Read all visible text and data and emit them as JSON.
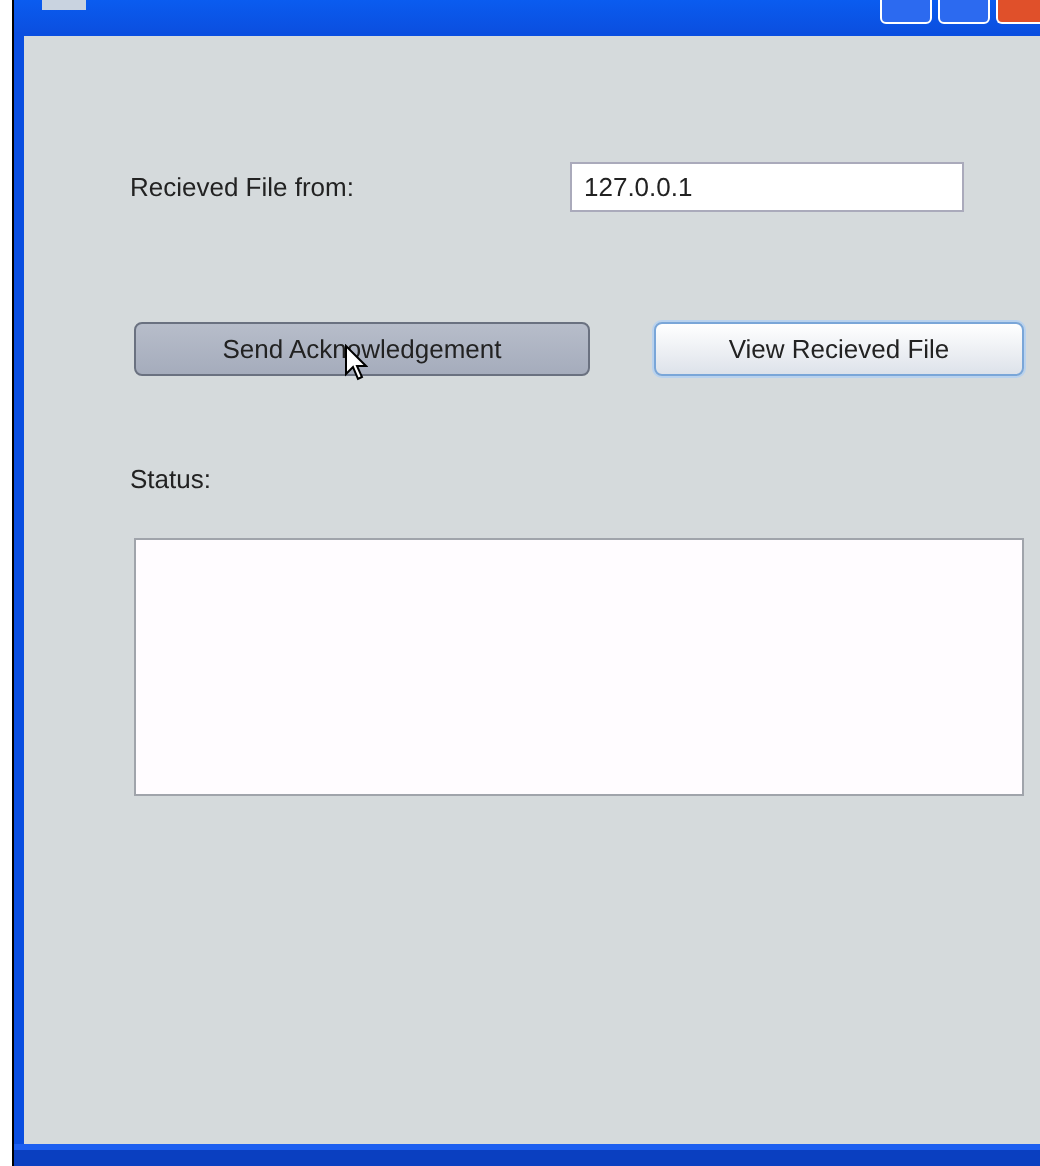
{
  "window": {
    "buttons": [
      {
        "kind": "minimize"
      },
      {
        "kind": "maximize"
      },
      {
        "kind": "close"
      }
    ]
  },
  "source": {
    "label": "Recieved File from:",
    "value": "127.0.0.1"
  },
  "actions": [
    {
      "label": "Send Acknowledgement",
      "pressed": true,
      "focused": false
    },
    {
      "label": "View Recieved File",
      "pressed": false,
      "focused": true
    }
  ],
  "status": {
    "label": "Status:"
  }
}
